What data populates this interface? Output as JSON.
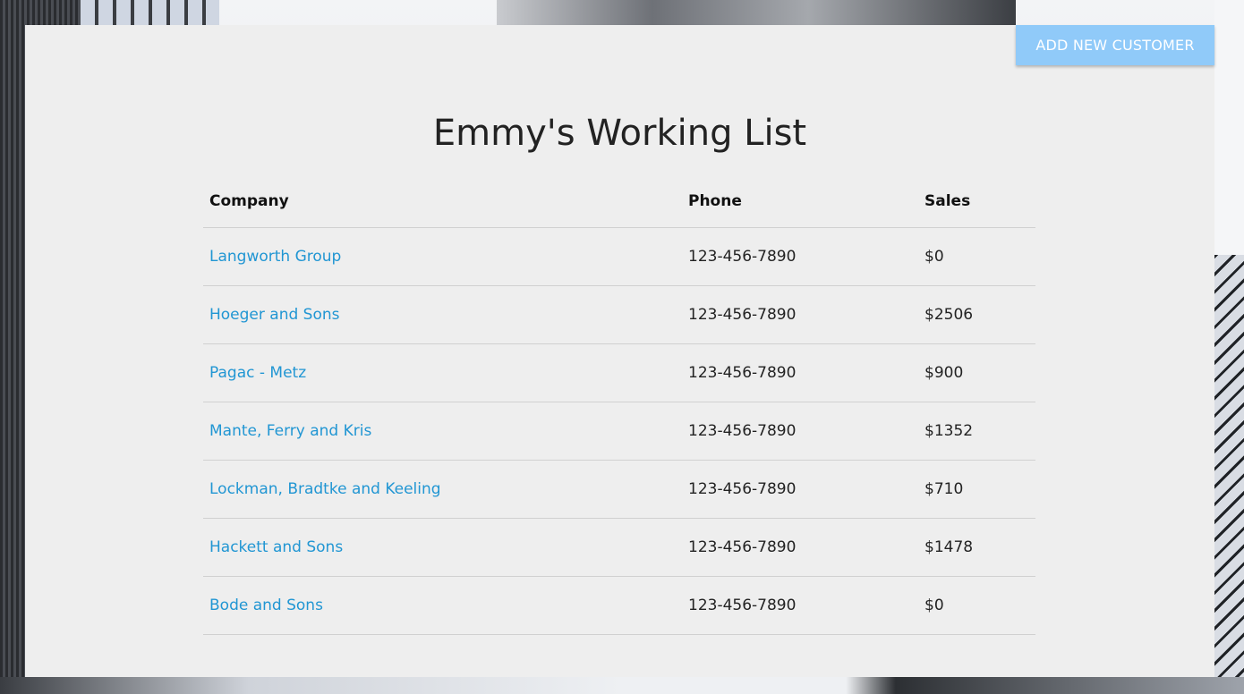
{
  "header": {
    "add_button_label": "ADD NEW CUSTOMER"
  },
  "main": {
    "title": "Emmy's Working List"
  },
  "table": {
    "columns": [
      "Company",
      "Phone",
      "Sales"
    ],
    "rows": [
      {
        "company": "Langworth Group",
        "phone": "123-456-7890",
        "sales": "$0"
      },
      {
        "company": "Hoeger and Sons",
        "phone": "123-456-7890",
        "sales": "$2506"
      },
      {
        "company": "Pagac - Metz",
        "phone": "123-456-7890",
        "sales": "$900"
      },
      {
        "company": "Mante, Ferry and Kris",
        "phone": "123-456-7890",
        "sales": "$1352"
      },
      {
        "company": "Lockman, Bradtke and Keeling",
        "phone": "123-456-7890",
        "sales": "$710"
      },
      {
        "company": "Hackett and Sons",
        "phone": "123-456-7890",
        "sales": "$1478"
      },
      {
        "company": "Bode and Sons",
        "phone": "123-456-7890",
        "sales": "$0"
      }
    ]
  },
  "colors": {
    "accent_button": "#90caf9",
    "link": "#2196d3",
    "panel_background": "#eeeeee"
  }
}
